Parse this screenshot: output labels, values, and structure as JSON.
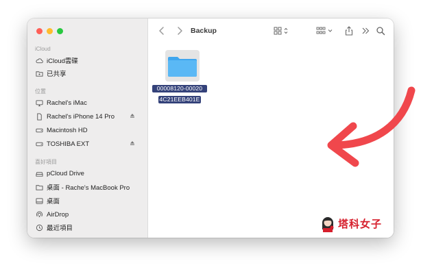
{
  "window": {
    "title": "Backup"
  },
  "sidebar": {
    "sections": [
      {
        "title": "iCloud",
        "items": [
          {
            "label": "iCloud雲碟",
            "icon": "cloud-icon"
          },
          {
            "label": "已共享",
            "icon": "shared-folder-icon"
          }
        ]
      },
      {
        "title": "位置",
        "items": [
          {
            "label": "Rachel's iMac",
            "icon": "imac-icon"
          },
          {
            "label": "Rachel's  iPhone 14 Pro",
            "icon": "iphone-icon",
            "eject": true
          },
          {
            "label": "Macintosh HD",
            "icon": "disk-icon"
          },
          {
            "label": "TOSHIBA EXT",
            "icon": "disk-icon",
            "eject": true
          }
        ]
      },
      {
        "title": "喜好項目",
        "items": [
          {
            "label": "pCloud Drive",
            "icon": "drive-icon"
          },
          {
            "label": "桌面 - Rache's MacBook Pro",
            "icon": "folder-icon"
          },
          {
            "label": "桌面",
            "icon": "desktop-icon"
          },
          {
            "label": "AirDrop",
            "icon": "airdrop-icon"
          },
          {
            "label": "最近項目",
            "icon": "clock-icon"
          }
        ]
      }
    ]
  },
  "files": [
    {
      "name_line1": "00008120-00020",
      "name_line2": "4C21EEB401E"
    }
  ],
  "watermark": {
    "text": "塔科女子"
  },
  "colors": {
    "selection": "#34427a",
    "folder": "#5ab8f5",
    "arrow": "#f0474c",
    "brand": "#d61f2c"
  }
}
